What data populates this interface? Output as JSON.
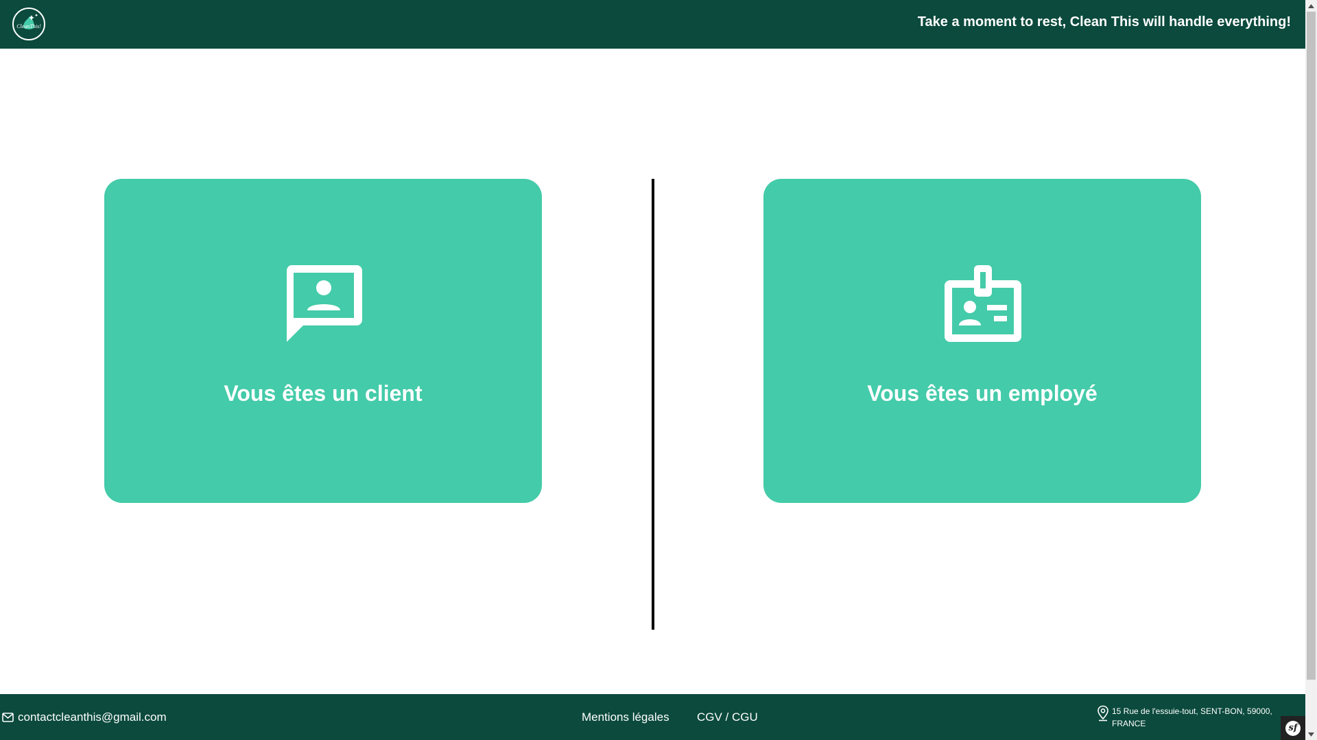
{
  "header": {
    "logo_text": "CleanThis!",
    "tagline": "Take a moment to rest, Clean This will handle everything!"
  },
  "cards": {
    "client": {
      "label": "Vous êtes un client",
      "icon": "user-chat-icon"
    },
    "employee": {
      "label": "Vous êtes un employé",
      "icon": "id-badge-icon"
    }
  },
  "footer": {
    "email": "contactcleanthis@gmail.com",
    "legal_link": "Mentions légales",
    "cgv_link": "CGV / CGU",
    "address": "15 Rue de l'essuie-tout, SENT-BON, 59000, FRANCE"
  },
  "toolbar": {
    "badge_label": "sf"
  },
  "colors": {
    "header_bg": "#0b4a3d",
    "card_bg": "#44cba9",
    "text_light": "#ffffff"
  }
}
